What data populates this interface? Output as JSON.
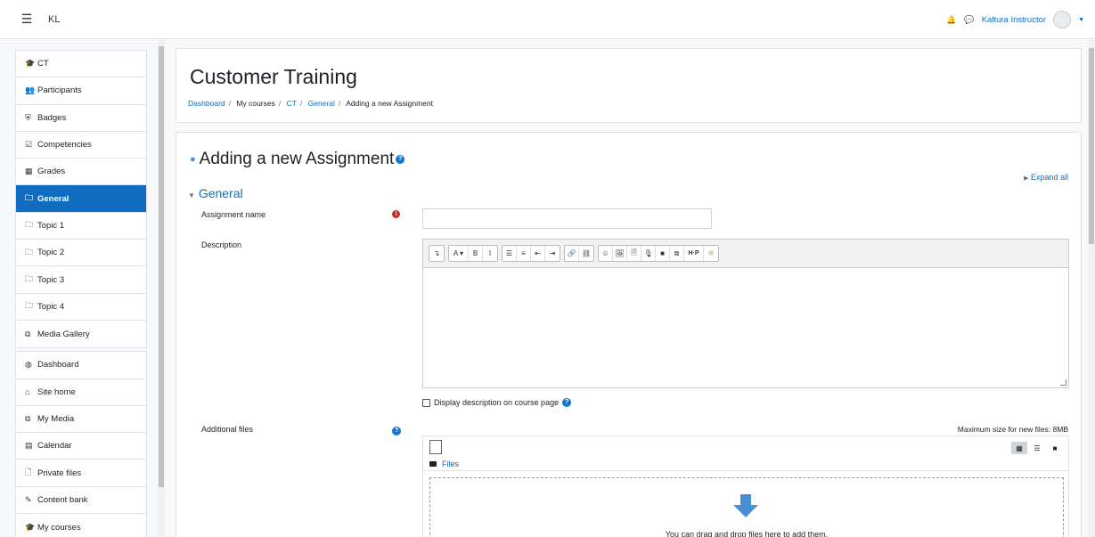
{
  "navbar": {
    "menu_icon": "hamburger-icon",
    "brand": "KL",
    "username": "Kaltura Instructor"
  },
  "sidebar": {
    "course_items": [
      {
        "icon": "graduation-cap-icon",
        "glyph": "🎓",
        "label": "CT"
      },
      {
        "icon": "users-icon",
        "glyph": "👥",
        "label": "Participants"
      },
      {
        "icon": "shield-icon",
        "glyph": "⛨",
        "label": "Badges"
      },
      {
        "icon": "check-square-icon",
        "glyph": "☑",
        "label": "Competencies"
      },
      {
        "icon": "table-icon",
        "glyph": "▦",
        "label": "Grades"
      },
      {
        "icon": "folder-icon",
        "glyph": "🗀",
        "label": "General"
      },
      {
        "icon": "folder-icon",
        "glyph": "🗀",
        "label": "Topic 1"
      },
      {
        "icon": "folder-icon",
        "glyph": "🗀",
        "label": "Topic 2"
      },
      {
        "icon": "folder-icon",
        "glyph": "🗀",
        "label": "Topic 3"
      },
      {
        "icon": "folder-icon",
        "glyph": "🗀",
        "label": "Topic 4"
      },
      {
        "icon": "media-icon",
        "glyph": "⧉",
        "label": "Media Gallery"
      }
    ],
    "site_items": [
      {
        "icon": "dashboard-icon",
        "glyph": "◍",
        "label": "Dashboard"
      },
      {
        "icon": "home-icon",
        "glyph": "⌂",
        "label": "Site home"
      },
      {
        "icon": "media-icon",
        "glyph": "⧉",
        "label": "My Media"
      },
      {
        "icon": "calendar-icon",
        "glyph": "▤",
        "label": "Calendar"
      },
      {
        "icon": "file-icon",
        "glyph": "🗋",
        "label": "Private files"
      },
      {
        "icon": "pen-icon",
        "glyph": "✎",
        "label": "Content bank"
      },
      {
        "icon": "graduation-cap-icon",
        "glyph": "🎓",
        "label": "My courses"
      }
    ],
    "active_label": "General"
  },
  "header": {
    "title": "Customer Training",
    "breadcrumb": [
      "Dashboard",
      "My courses",
      "CT",
      "General",
      "Adding a new Assignment"
    ]
  },
  "form": {
    "heading": "Adding a new Assignment",
    "expand_all": "Expand all",
    "section": "General",
    "assignment_name_label": "Assignment name",
    "assignment_name_value": "",
    "description_label": "Description",
    "display_description_label": "Display description on course page",
    "additional_files_label": "Additional files",
    "max_size": "Maximum size for new files: 8MB",
    "files_path": "Files",
    "drop_text": "You can drag and drop files here to add them."
  },
  "toolbar": {
    "buttons": [
      [
        "↴"
      ],
      [
        "A ▾",
        "B",
        "I"
      ],
      [
        "☰",
        "≡",
        "⇤",
        "⇥"
      ],
      [
        "🔗",
        "⛓"
      ],
      [
        "☺",
        "🖼",
        "🗎",
        "🎙",
        "■",
        "⧉",
        "H·P",
        "✲"
      ]
    ]
  },
  "colors": {
    "accent": "#0f6cbf",
    "required": "#ca3120",
    "help": "#1177d1",
    "dropzone_arrow": "#4a8ed6"
  }
}
